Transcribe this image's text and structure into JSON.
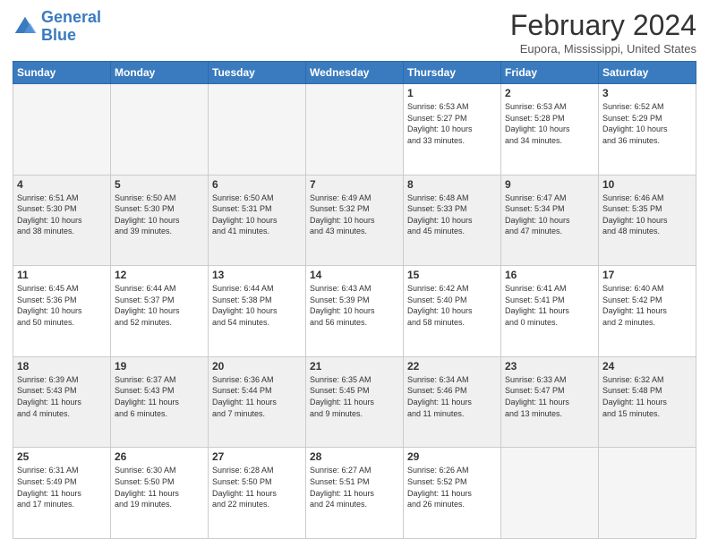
{
  "header": {
    "logo_line1": "General",
    "logo_line2": "Blue",
    "month_year": "February 2024",
    "location": "Eupora, Mississippi, United States"
  },
  "weekdays": [
    "Sunday",
    "Monday",
    "Tuesday",
    "Wednesday",
    "Thursday",
    "Friday",
    "Saturday"
  ],
  "weeks": [
    [
      {
        "day": "",
        "info": ""
      },
      {
        "day": "",
        "info": ""
      },
      {
        "day": "",
        "info": ""
      },
      {
        "day": "",
        "info": ""
      },
      {
        "day": "1",
        "info": "Sunrise: 6:53 AM\nSunset: 5:27 PM\nDaylight: 10 hours\nand 33 minutes."
      },
      {
        "day": "2",
        "info": "Sunrise: 6:53 AM\nSunset: 5:28 PM\nDaylight: 10 hours\nand 34 minutes."
      },
      {
        "day": "3",
        "info": "Sunrise: 6:52 AM\nSunset: 5:29 PM\nDaylight: 10 hours\nand 36 minutes."
      }
    ],
    [
      {
        "day": "4",
        "info": "Sunrise: 6:51 AM\nSunset: 5:30 PM\nDaylight: 10 hours\nand 38 minutes."
      },
      {
        "day": "5",
        "info": "Sunrise: 6:50 AM\nSunset: 5:30 PM\nDaylight: 10 hours\nand 39 minutes."
      },
      {
        "day": "6",
        "info": "Sunrise: 6:50 AM\nSunset: 5:31 PM\nDaylight: 10 hours\nand 41 minutes."
      },
      {
        "day": "7",
        "info": "Sunrise: 6:49 AM\nSunset: 5:32 PM\nDaylight: 10 hours\nand 43 minutes."
      },
      {
        "day": "8",
        "info": "Sunrise: 6:48 AM\nSunset: 5:33 PM\nDaylight: 10 hours\nand 45 minutes."
      },
      {
        "day": "9",
        "info": "Sunrise: 6:47 AM\nSunset: 5:34 PM\nDaylight: 10 hours\nand 47 minutes."
      },
      {
        "day": "10",
        "info": "Sunrise: 6:46 AM\nSunset: 5:35 PM\nDaylight: 10 hours\nand 48 minutes."
      }
    ],
    [
      {
        "day": "11",
        "info": "Sunrise: 6:45 AM\nSunset: 5:36 PM\nDaylight: 10 hours\nand 50 minutes."
      },
      {
        "day": "12",
        "info": "Sunrise: 6:44 AM\nSunset: 5:37 PM\nDaylight: 10 hours\nand 52 minutes."
      },
      {
        "day": "13",
        "info": "Sunrise: 6:44 AM\nSunset: 5:38 PM\nDaylight: 10 hours\nand 54 minutes."
      },
      {
        "day": "14",
        "info": "Sunrise: 6:43 AM\nSunset: 5:39 PM\nDaylight: 10 hours\nand 56 minutes."
      },
      {
        "day": "15",
        "info": "Sunrise: 6:42 AM\nSunset: 5:40 PM\nDaylight: 10 hours\nand 58 minutes."
      },
      {
        "day": "16",
        "info": "Sunrise: 6:41 AM\nSunset: 5:41 PM\nDaylight: 11 hours\nand 0 minutes."
      },
      {
        "day": "17",
        "info": "Sunrise: 6:40 AM\nSunset: 5:42 PM\nDaylight: 11 hours\nand 2 minutes."
      }
    ],
    [
      {
        "day": "18",
        "info": "Sunrise: 6:39 AM\nSunset: 5:43 PM\nDaylight: 11 hours\nand 4 minutes."
      },
      {
        "day": "19",
        "info": "Sunrise: 6:37 AM\nSunset: 5:43 PM\nDaylight: 11 hours\nand 6 minutes."
      },
      {
        "day": "20",
        "info": "Sunrise: 6:36 AM\nSunset: 5:44 PM\nDaylight: 11 hours\nand 7 minutes."
      },
      {
        "day": "21",
        "info": "Sunrise: 6:35 AM\nSunset: 5:45 PM\nDaylight: 11 hours\nand 9 minutes."
      },
      {
        "day": "22",
        "info": "Sunrise: 6:34 AM\nSunset: 5:46 PM\nDaylight: 11 hours\nand 11 minutes."
      },
      {
        "day": "23",
        "info": "Sunrise: 6:33 AM\nSunset: 5:47 PM\nDaylight: 11 hours\nand 13 minutes."
      },
      {
        "day": "24",
        "info": "Sunrise: 6:32 AM\nSunset: 5:48 PM\nDaylight: 11 hours\nand 15 minutes."
      }
    ],
    [
      {
        "day": "25",
        "info": "Sunrise: 6:31 AM\nSunset: 5:49 PM\nDaylight: 11 hours\nand 17 minutes."
      },
      {
        "day": "26",
        "info": "Sunrise: 6:30 AM\nSunset: 5:50 PM\nDaylight: 11 hours\nand 19 minutes."
      },
      {
        "day": "27",
        "info": "Sunrise: 6:28 AM\nSunset: 5:50 PM\nDaylight: 11 hours\nand 22 minutes."
      },
      {
        "day": "28",
        "info": "Sunrise: 6:27 AM\nSunset: 5:51 PM\nDaylight: 11 hours\nand 24 minutes."
      },
      {
        "day": "29",
        "info": "Sunrise: 6:26 AM\nSunset: 5:52 PM\nDaylight: 11 hours\nand 26 minutes."
      },
      {
        "day": "",
        "info": ""
      },
      {
        "day": "",
        "info": ""
      }
    ]
  ]
}
